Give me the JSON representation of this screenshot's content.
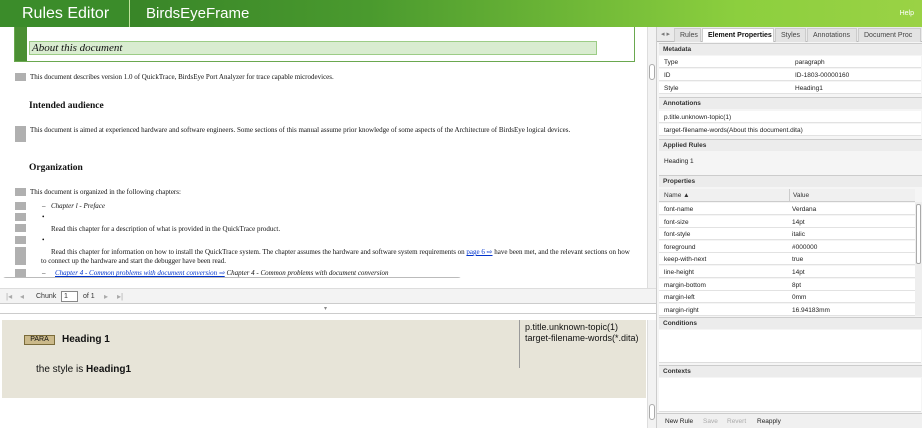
{
  "header": {
    "app_title": "Rules Editor",
    "frame_title": "BirdsEyeFrame",
    "help": "Help"
  },
  "document": {
    "title": "About this document",
    "p1": "This document describes version 1.0 of QuickTrace, BirdsEye Port Analyzer for trace capable microdevices.",
    "h_audience": "Intended audience",
    "p2": "This document is aimed at experienced hardware and software engineers. Some sections of this manual assume prior knowledge of some aspects of the Architecture of BirdsEye logical devices.",
    "h_org": "Organization",
    "p3": "This document is organized in the following chapters:",
    "items": [
      {
        "bullet": "–",
        "text": "Chapter l - Preface"
      },
      {
        "bullet": "•",
        "text": ""
      },
      {
        "bullet": "",
        "text": "Read this chapter for a description of what is provided in the QuickTrace product."
      },
      {
        "bullet": "•",
        "text": ""
      },
      {
        "bullet": "",
        "text": "Read this chapter for information on how to install the QuickTrace system. The chapter assumes the hardware and software system requirements on"
      }
    ],
    "page_link": "page 6 ⇨",
    "cont_text": "have been met, and the relevant sections on how to connect up the hardware and start the debugger have been read.",
    "chapter4_link": "Chapter 4 - Common problems with document conversion ⇨",
    "chapter4_text": "Chapter 4 - Common problems with document conversion"
  },
  "chunk_nav": {
    "label": "Chunk",
    "value": "1",
    "of": "of 1"
  },
  "preview": {
    "badge": "PARA",
    "heading": "Heading 1",
    "style_prefix": "the style is ",
    "style_value": "Heading1",
    "right_line1": "p.title.unknown-topic(1)",
    "right_line2": "target-filename-words(*.dita)"
  },
  "right_panel": {
    "tabs": [
      "Rules",
      "Element Properties",
      "Styles",
      "Annotations",
      "Document Proc"
    ],
    "active_tab": "Element Properties",
    "metadata_title": "Metadata",
    "metadata": [
      {
        "k": "Type",
        "v": "paragraph"
      },
      {
        "k": "ID",
        "v": "ID-1803-00000160"
      },
      {
        "k": "Style",
        "v": "Heading1"
      }
    ],
    "annotations_title": "Annotations",
    "annotations": [
      "p.title.unknown-topic(1)",
      "target-filename-words(About this document.dita)"
    ],
    "applied_title": "Applied Rules",
    "applied": [
      "Heading 1"
    ],
    "properties_title": "Properties",
    "prop_col_name": "Name ▲",
    "prop_col_value": "Value",
    "properties": [
      {
        "k": "font-name",
        "v": "Verdana"
      },
      {
        "k": "font-size",
        "v": "14pt"
      },
      {
        "k": "font-style",
        "v": "italic"
      },
      {
        "k": "foreground",
        "v": "#000000"
      },
      {
        "k": "keep-with-next",
        "v": "true"
      },
      {
        "k": "line-height",
        "v": "14pt"
      },
      {
        "k": "margin-bottom",
        "v": "8pt"
      },
      {
        "k": "margin-left",
        "v": "0mm"
      },
      {
        "k": "margin-right",
        "v": "16.94183mm"
      }
    ],
    "conditions_title": "Conditions",
    "contexts_title": "Contexts",
    "footer": {
      "new_rule": "New Rule",
      "save": "Save",
      "revert": "Revert",
      "reapply": "Reapply"
    }
  }
}
